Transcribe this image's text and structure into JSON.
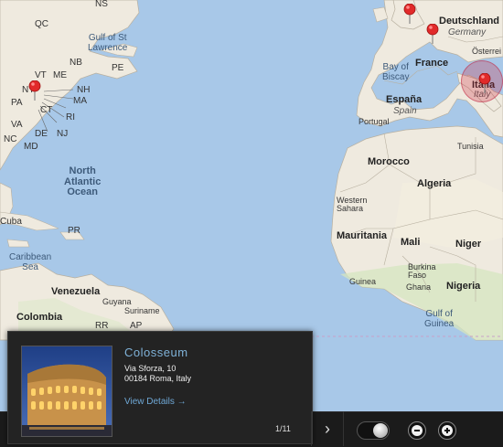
{
  "map": {
    "labels": {
      "us_states": [
        "ME",
        "VT",
        "NH",
        "NB",
        "PE",
        "NY",
        "MA",
        "PA",
        "CT",
        "RI",
        "NJ",
        "VA",
        "DE",
        "NC",
        "MD",
        "QC"
      ],
      "gulf": "Gulf of St\nLawrence",
      "north_atlantic": "North\nAtlantic\nOcean",
      "bay_of_biscay": "Bay of\nBiscay",
      "caribbean": "Caribbean\nSea",
      "gulf_guinea": "Gulf of\nGuinea",
      "countries": {
        "deutschland": "Deutschland",
        "germany": "Germany",
        "osterreich": "Österrei",
        "france": "France",
        "espana": "España",
        "spain": "Spain",
        "portugal": "Portugal",
        "italia": "Italia",
        "italy": "Italy",
        "tunisia": "Tunisia",
        "morocco": "Morocco",
        "algeria": "Algeria",
        "western_sahara": "Western\nSahara",
        "mauritania": "Mauritania",
        "mali": "Mali",
        "niger": "Niger",
        "burkina": "Burkina\nFaso",
        "guinea": "Guinea",
        "ghana": "Ghana",
        "nigeria": "Nigeria",
        "cuba": "Cuba",
        "pr": "PR",
        "venezuela": "Venezuela",
        "guyana": "Guyana",
        "suriname": "Suriname",
        "colombia": "Colombia",
        "rr": "RR",
        "ap": "AP",
        "ns": "NS"
      }
    },
    "pins": [
      "new-york-pin",
      "england-pin",
      "paris-pin",
      "rome-pin"
    ]
  },
  "card": {
    "title": "Colosseum",
    "address_line1": "Via Sforza, 10",
    "address_line2": "00184 Roma, Italy",
    "view_details": "View Details →",
    "counter": "1/11"
  },
  "controls": {
    "next": "›"
  }
}
